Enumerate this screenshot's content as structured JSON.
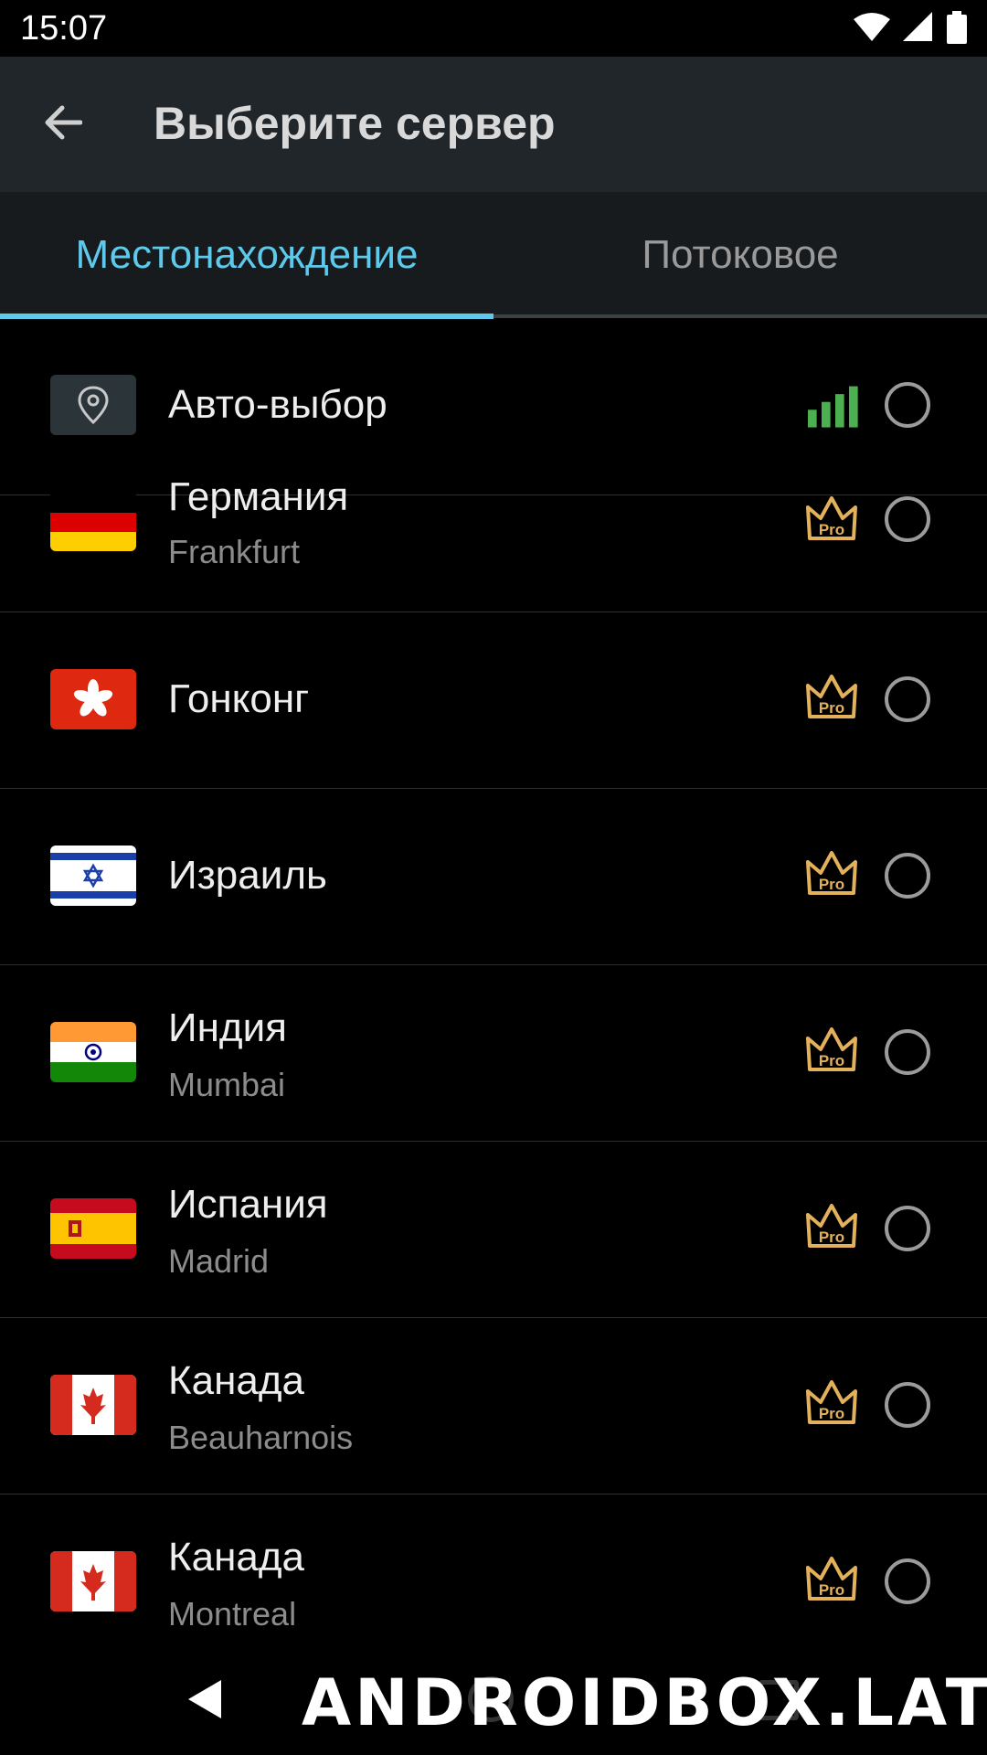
{
  "status_bar": {
    "time": "15:07"
  },
  "app_bar": {
    "title": "Выберите сервер"
  },
  "tabs": [
    {
      "label": "Местонахождение",
      "selected": true
    },
    {
      "label": "Потоковое",
      "selected": false
    }
  ],
  "servers": [
    {
      "name": "Авто-выбор",
      "city": "",
      "icon": "location-pin-icon",
      "indicator": "signal-bars-icon"
    },
    {
      "name": "Германия",
      "city": "Frankfurt",
      "icon": "flag-germany",
      "indicator": "pro-crown-icon"
    },
    {
      "name": "Гонконг",
      "city": "",
      "icon": "flag-hong-kong",
      "indicator": "pro-crown-icon"
    },
    {
      "name": "Израиль",
      "city": "",
      "icon": "flag-israel",
      "indicator": "pro-crown-icon"
    },
    {
      "name": "Индия",
      "city": "Mumbai",
      "icon": "flag-india",
      "indicator": "pro-crown-icon"
    },
    {
      "name": "Испания",
      "city": "Madrid",
      "icon": "flag-spain",
      "indicator": "pro-crown-icon"
    },
    {
      "name": "Канада",
      "city": "Beauharnois",
      "icon": "flag-canada",
      "indicator": "pro-crown-icon"
    },
    {
      "name": "Канада",
      "city": "Montreal",
      "icon": "flag-canada",
      "indicator": "pro-crown-icon"
    }
  ],
  "pro_badge_text": "Pro",
  "watermark": "ANDROIDBOX.LAT",
  "colors": {
    "accent": "#5ec9ea",
    "pro": "#e3b15a",
    "signal": "#4caf50",
    "app_bar": "#20262a",
    "tab_bar": "#171b1e"
  }
}
